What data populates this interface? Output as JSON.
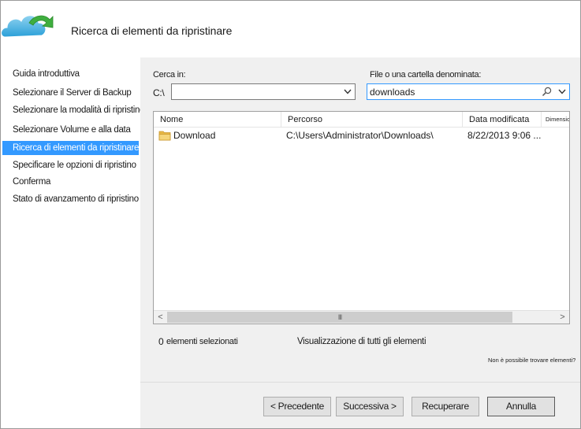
{
  "header": {
    "title": "Ricerca di elementi da ripristinare",
    "logo_icon": "cloud-arrow-icon"
  },
  "nav": {
    "items": [
      {
        "label": "Guida introduttiva",
        "active": false
      },
      {
        "label": "Selezionare il Server di Backup",
        "active": false
      },
      {
        "label": "Selezionare la modalità di ripristino",
        "active": false
      },
      {
        "label": "Selezionare Volume e alla data",
        "active": false
      },
      {
        "label": "Ricerca di elementi da ripristinare",
        "active": true
      },
      {
        "label": "Specificare le opzioni di ripristino",
        "active": false
      },
      {
        "label": "Conferma",
        "active": false
      },
      {
        "label": "Stato di avanzamento di ripristino",
        "active": false
      }
    ]
  },
  "search": {
    "look_in_label": "Cerca in:",
    "drive_label": "C:\\",
    "look_in_value": "",
    "named_label": "File o una cartella denominata:",
    "named_value": "downloads"
  },
  "list": {
    "columns": [
      "Nome",
      "Percorso",
      "Data modificata",
      "Dimensioni"
    ],
    "rows": [
      {
        "name": "Download",
        "path": "C:\\Users\\Administrator\\Downloads\\",
        "modified": "8/22/2013 9:06 ...",
        "size": ""
      }
    ],
    "scroll_grip": "III",
    "scroll_left": "<",
    "scroll_right": ">"
  },
  "status": {
    "selected_count": "0",
    "selected_label": "elementi selezionati",
    "showing_label": "Visualizzazione di tutti gli elementi",
    "not_found_link": "Non è possibile trovare elementi?"
  },
  "buttons": {
    "back": "< Precedente",
    "next": "Successiva >",
    "recover": "Recuperare",
    "cancel": "Annulla"
  },
  "colors": {
    "accent": "#3399ff",
    "panel": "#f0f0f0"
  }
}
